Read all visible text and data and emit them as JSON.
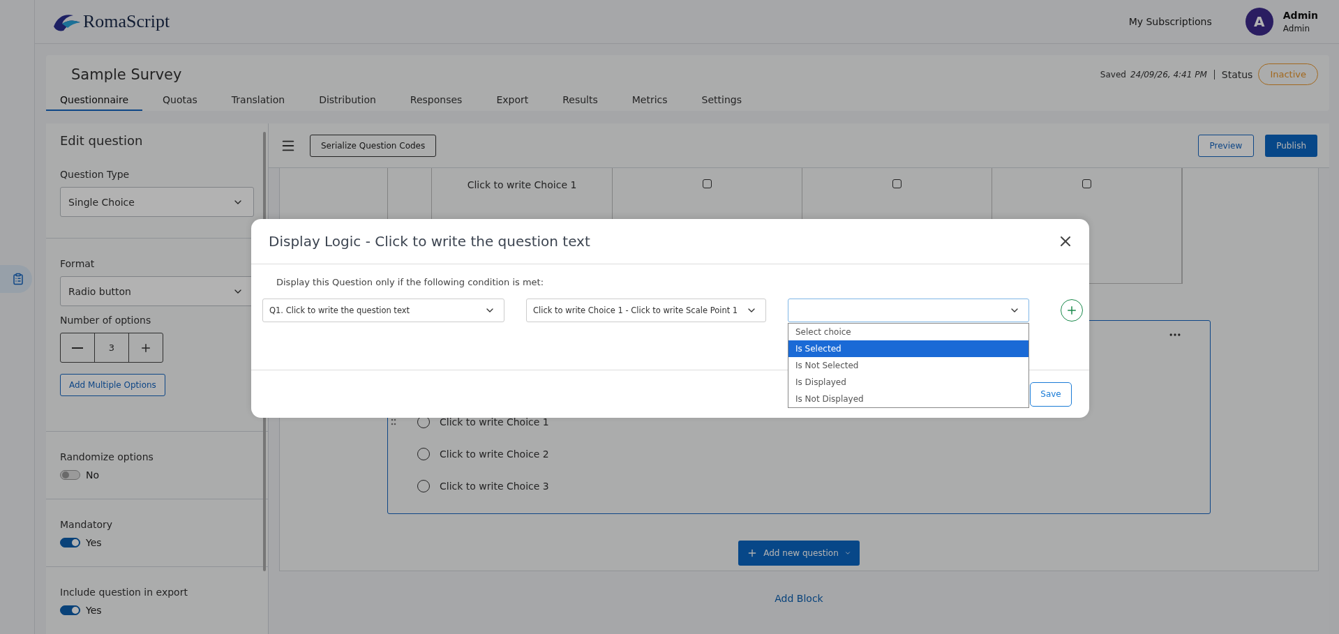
{
  "header": {
    "logo": "RomaScript",
    "link": "My Subscriptions",
    "user": {
      "initial": "A",
      "name": "Admin",
      "role": "Admin"
    }
  },
  "survey": {
    "title": "Sample Survey",
    "saved_label": "Saved",
    "saved_time": "24/09/26, 4:41 PM",
    "status_label": "Status",
    "status": "Inactive",
    "tabs": [
      {
        "label": "Questionnaire",
        "selected": true
      },
      {
        "label": "Quotas",
        "selected": false
      },
      {
        "label": "Translation",
        "selected": false
      },
      {
        "label": "Distribution",
        "selected": false
      },
      {
        "label": "Responses",
        "selected": false
      },
      {
        "label": "Export",
        "selected": false
      },
      {
        "label": "Results",
        "selected": false
      },
      {
        "label": "Metrics",
        "selected": false
      },
      {
        "label": "Settings",
        "selected": false
      }
    ]
  },
  "edit_panel": {
    "title": "Edit question",
    "question_type": {
      "label": "Question Type",
      "value": "Single Choice"
    },
    "format": {
      "label": "Format",
      "value": "Radio button"
    },
    "options": {
      "label": "Number of options",
      "value": "3"
    },
    "add_multiple": "Add Multiple Options",
    "toggles": [
      {
        "label": "Randomize options",
        "on": false,
        "text": "No"
      },
      {
        "label": "Mandatory",
        "on": true,
        "text": "Yes"
      },
      {
        "label": "Include question in export",
        "on": true,
        "text": "Yes"
      }
    ]
  },
  "toolbar": {
    "serialize": "Serialize Question Codes",
    "preview": "Preview",
    "publish": "Publish"
  },
  "matrix": {
    "row": "Click to write Choice 1",
    "checked": [
      false,
      false,
      false
    ]
  },
  "question": {
    "choices": [
      {
        "label": "Click to write Choice 1",
        "selected": false
      },
      {
        "label": "Click to write Choice 2",
        "selected": false
      },
      {
        "label": "Click to write Choice 3",
        "selected": false
      }
    ]
  },
  "add_question": "Add new question",
  "add_block": "Add Block",
  "modal": {
    "title": "Display Logic - Click to write the question text",
    "instruction": "Display this Question only if the following condition is met:",
    "question_select": "Q1. Click to write the question text",
    "choice_select": "Click to write Choice 1 - Click to write Scale Point 1",
    "save": "Save",
    "condition_options": [
      {
        "label": "Select choice",
        "selected": false
      },
      {
        "label": "Is Selected",
        "selected": true
      },
      {
        "label": "Is Not Selected",
        "selected": false
      },
      {
        "label": "Is Displayed",
        "selected": false
      },
      {
        "label": "Is Not Displayed",
        "selected": false
      }
    ]
  }
}
